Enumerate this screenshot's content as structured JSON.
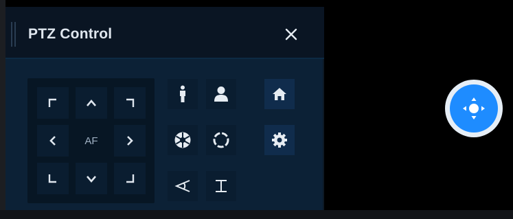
{
  "panel": {
    "title": "PTZ Control",
    "close_icon": "close-icon"
  },
  "dpad": {
    "center_label": "AF",
    "buttons": [
      "up-left",
      "up",
      "up-right",
      "left",
      "autofocus",
      "right",
      "down-left",
      "down",
      "down-right"
    ]
  },
  "tools": [
    {
      "name": "person-standing",
      "icon": "person-standing-icon"
    },
    {
      "name": "person-bust",
      "icon": "person-bust-icon"
    },
    {
      "name": "home",
      "icon": "home-icon"
    },
    {
      "name": "iris",
      "icon": "aperture-icon"
    },
    {
      "name": "focus-ring",
      "icon": "dashed-circle-icon"
    },
    {
      "name": "settings",
      "icon": "gear-icon"
    },
    {
      "name": "zoom-angle",
      "icon": "angle-icon"
    },
    {
      "name": "range",
      "icon": "bracket-icon"
    }
  ],
  "floating": {
    "icon": "ptz-move-icon",
    "color": "#1e8cff"
  },
  "colors": {
    "panel_bg": "#0c2136",
    "titlebar_bg": "#0a1523",
    "accent_blue": "#1e8cff",
    "text": "#dfe6ee"
  }
}
